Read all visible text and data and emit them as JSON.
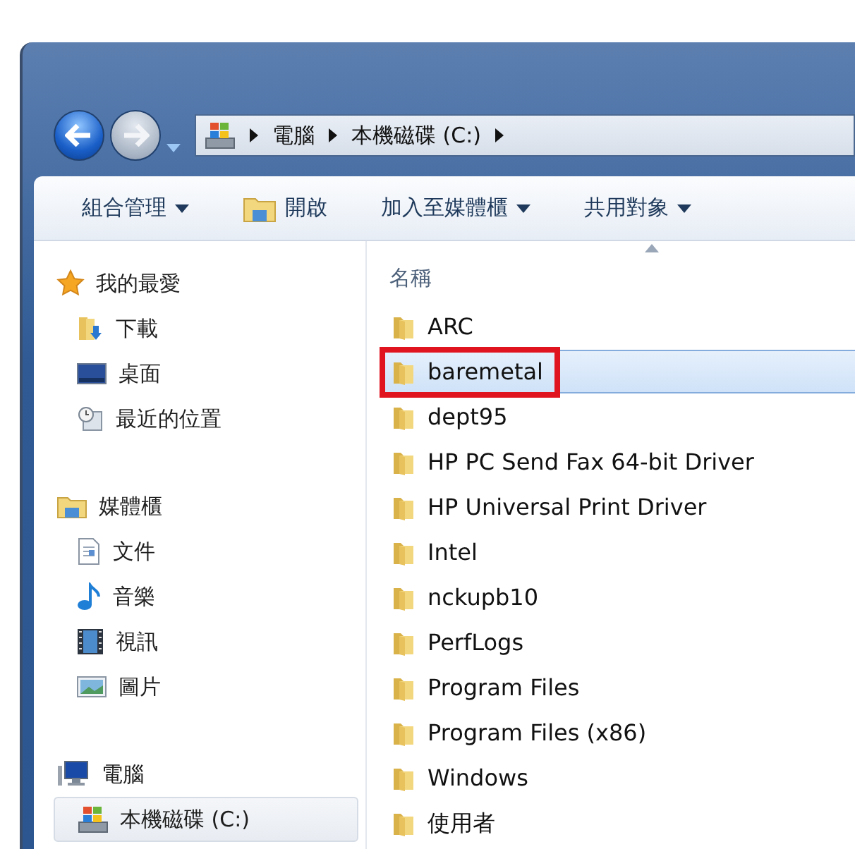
{
  "navigation": {
    "back_enabled": true,
    "forward_enabled": false
  },
  "address_bar": {
    "breadcrumbs": [
      "電腦",
      "本機磁碟 (C:)"
    ]
  },
  "toolbar": [
    {
      "label": "組合管理",
      "has_menu": true,
      "icon": false
    },
    {
      "label": "開啟",
      "has_menu": false,
      "icon": true
    },
    {
      "label": "加入至媒體櫃",
      "has_menu": true,
      "icon": false
    },
    {
      "label": "共用對象",
      "has_menu": true,
      "icon": false
    }
  ],
  "sidebar": {
    "groups": [
      {
        "label": "我的最愛",
        "kind": "favorites",
        "selected": false,
        "children": [
          {
            "label": "下載",
            "kind": "downloads",
            "selected": false
          },
          {
            "label": "桌面",
            "kind": "desktop",
            "selected": false
          },
          {
            "label": "最近的位置",
            "kind": "recent",
            "selected": false
          }
        ]
      },
      {
        "label": "媒體櫃",
        "kind": "libraries",
        "selected": false,
        "children": [
          {
            "label": "文件",
            "kind": "documents",
            "selected": false
          },
          {
            "label": "音樂",
            "kind": "music",
            "selected": false
          },
          {
            "label": "視訊",
            "kind": "videos",
            "selected": false
          },
          {
            "label": "圖片",
            "kind": "pictures",
            "selected": false
          }
        ]
      },
      {
        "label": "電腦",
        "kind": "computer",
        "selected": false,
        "children": [
          {
            "label": "本機磁碟 (C:)",
            "kind": "drive",
            "selected": true
          }
        ]
      }
    ]
  },
  "file_list": {
    "column": {
      "label": "名稱",
      "sort_ascending": true
    },
    "items": [
      {
        "name": "ARC",
        "selected": false,
        "annotated": false
      },
      {
        "name": "baremetal",
        "selected": true,
        "annotated": true
      },
      {
        "name": "dept95",
        "selected": false,
        "annotated": false
      },
      {
        "name": "HP PC Send Fax 64-bit Driver",
        "selected": false,
        "annotated": false
      },
      {
        "name": "HP Universal Print Driver",
        "selected": false,
        "annotated": false
      },
      {
        "name": "Intel",
        "selected": false,
        "annotated": false
      },
      {
        "name": "nckupb10",
        "selected": false,
        "annotated": false
      },
      {
        "name": "PerfLogs",
        "selected": false,
        "annotated": false
      },
      {
        "name": "Program Files",
        "selected": false,
        "annotated": false
      },
      {
        "name": "Program Files (x86)",
        "selected": false,
        "annotated": false
      },
      {
        "name": "Windows",
        "selected": false,
        "annotated": false
      },
      {
        "name": "使用者",
        "selected": false,
        "annotated": false
      }
    ]
  }
}
